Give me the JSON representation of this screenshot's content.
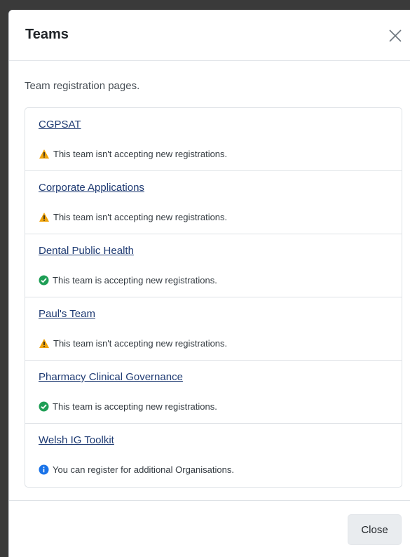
{
  "modal": {
    "title": "Teams",
    "intro": "Team registration pages.",
    "close_label": "Close"
  },
  "teams": [
    {
      "name": "CGPSAT",
      "status": "warning",
      "message": "This team isn't accepting new registrations."
    },
    {
      "name": "Corporate Applications",
      "status": "warning",
      "message": "This team isn't accepting new registrations."
    },
    {
      "name": "Dental Public Health",
      "status": "success",
      "message": "This team is accepting new registrations."
    },
    {
      "name": "Paul's Team",
      "status": "warning",
      "message": "This team isn't accepting new registrations."
    },
    {
      "name": "Pharmacy Clinical Governance",
      "status": "success",
      "message": "This team is accepting new registrations."
    },
    {
      "name": "Welsh IG Toolkit",
      "status": "info",
      "message": "You can register for additional Organisations."
    }
  ],
  "colors": {
    "warning": "#f0a30a",
    "success": "#1e9e55",
    "info": "#1a73e8",
    "link": "#1f3b73"
  }
}
